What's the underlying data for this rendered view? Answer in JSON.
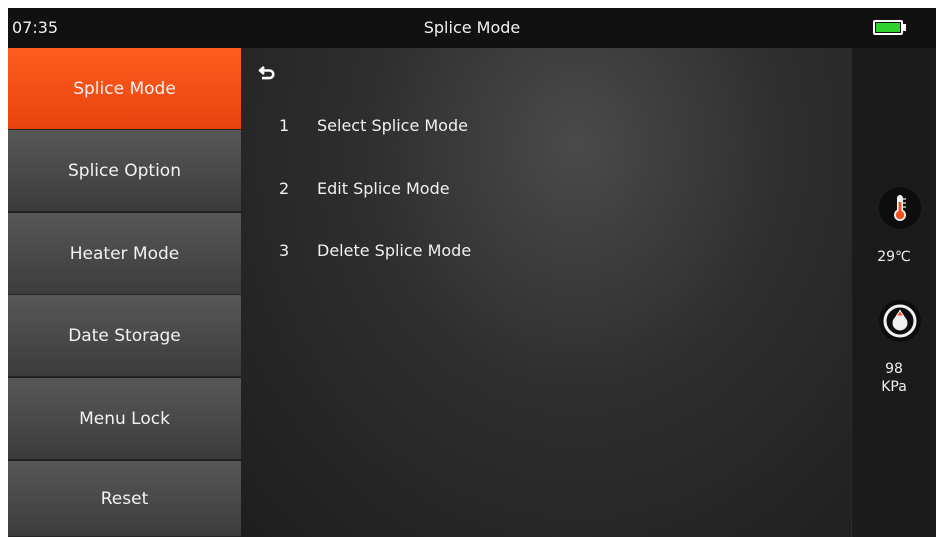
{
  "status_bar": {
    "time": "07:35",
    "title": "Splice Mode",
    "battery_icon": "battery-full-icon",
    "battery_color": "#2fd12f"
  },
  "sidebar": {
    "items": [
      {
        "label": "Splice Mode",
        "active": true
      },
      {
        "label": "Splice Option",
        "active": false
      },
      {
        "label": "Heater Mode",
        "active": false
      },
      {
        "label": "Date Storage",
        "active": false
      },
      {
        "label": "Menu Lock",
        "active": false
      },
      {
        "label": "Reset",
        "active": false
      }
    ],
    "active_color": "#f4501a"
  },
  "main": {
    "back_icon": "back-arrow-icon",
    "menu": [
      {
        "number": "1",
        "label": "Select Splice Mode"
      },
      {
        "number": "2",
        "label": "Edit Splice Mode"
      },
      {
        "number": "3",
        "label": "Delete Splice Mode"
      }
    ]
  },
  "sensors": {
    "temperature": {
      "icon": "thermometer-icon",
      "value": "29℃"
    },
    "pressure": {
      "icon": "pressure-gauge-icon",
      "value": "98",
      "unit": "KPa"
    }
  }
}
